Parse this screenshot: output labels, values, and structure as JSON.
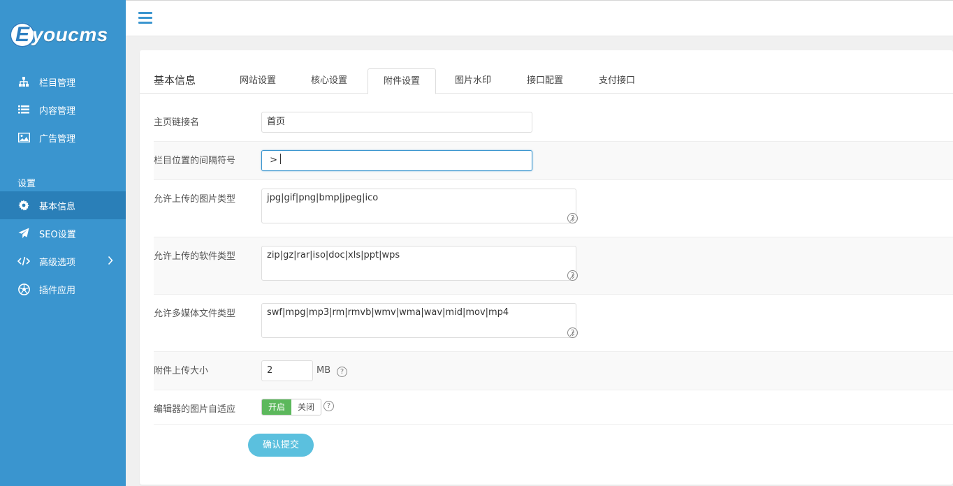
{
  "logo": {
    "letter": "E",
    "text": "youcms"
  },
  "sidebar": {
    "items": [
      {
        "label": "栏目管理",
        "icon": "sitemap-icon"
      },
      {
        "label": "内容管理",
        "icon": "list-icon"
      },
      {
        "label": "广告管理",
        "icon": "image-icon"
      }
    ],
    "section_title": "设置",
    "settings_items": [
      {
        "label": "基本信息",
        "icon": "gear-icon",
        "active": true
      },
      {
        "label": "SEO设置",
        "icon": "paper-plane-icon"
      },
      {
        "label": "高级选项",
        "icon": "code-icon",
        "has_arrow": true
      },
      {
        "label": "插件应用",
        "icon": "soccer-ball-icon"
      }
    ]
  },
  "page": {
    "title": "基本信息",
    "tabs": [
      {
        "label": "网站设置"
      },
      {
        "label": "核心设置"
      },
      {
        "label": "附件设置",
        "active": true
      },
      {
        "label": "图片水印"
      },
      {
        "label": "接口配置"
      },
      {
        "label": "支付接口"
      }
    ]
  },
  "form": {
    "home_link_label": "主页链接名",
    "home_link_value": "首页",
    "separator_label": "栏目位置的间隔符号",
    "separator_value": " > ",
    "image_types_label": "允许上传的图片类型",
    "image_types_value": "jpg|gif|png|bmp|jpeg|ico",
    "software_types_label": "允许上传的软件类型",
    "software_types_value": "zip|gz|rar|iso|doc|xls|ppt|wps",
    "media_types_label": "允许多媒体文件类型",
    "media_types_value": "swf|mpg|mp3|rm|rmvb|wmv|wma|wav|mid|mov|mp4",
    "attach_size_label": "附件上传大小",
    "attach_size_value": "2",
    "attach_size_unit": "MB",
    "editor_adapt_label": "编辑器的图片自适应",
    "toggle_on": "开启",
    "toggle_off": "关闭",
    "help_glyph": "?",
    "submit_label": "确认提交"
  },
  "colors": {
    "sidebar_bg": "#3a95cf",
    "sidebar_active": "#2a7fb8",
    "toggle_on": "#5cb85c",
    "submit": "#5bc0de"
  }
}
